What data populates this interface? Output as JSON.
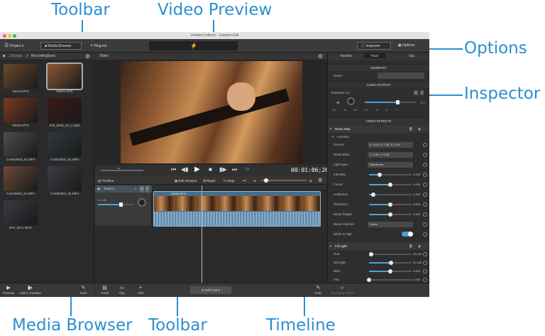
{
  "callouts": {
    "toolbar_top": "Toolbar",
    "video_preview": "Video Preview",
    "options": "Options",
    "inspector": "Inspector",
    "media_browser": "Media Browser",
    "toolbar_bottom": "Toolbar",
    "timeline": "Timeline"
  },
  "colors": {
    "accent": "#2b8fd0",
    "app_bg": "#2c2c2c",
    "selection": "#4aa3df"
  },
  "window": {
    "title": "Untitled (edited) - Catalyst Edit"
  },
  "topbar": {
    "project": "Project",
    "media_browser": "Media Browser",
    "plugins": "Plug-ins",
    "inspector": "Inspector",
    "options": "Options"
  },
  "media_browser": {
    "location_root": "Desktop",
    "location_sep": ">",
    "location_folder": "RecordingSess",
    "items": [
      {
        "name": "00013.MTS",
        "color": "#6b4a2c"
      },
      {
        "name": "00031.MTS",
        "color": "#8a5a34"
      },
      {
        "name": "00034.MTS",
        "color": "#7a3a22"
      },
      {
        "name": "049_0043_01_1.mp4",
        "color": "#3a1a18"
      },
      {
        "name": "CAM10003_01.MP4",
        "color": "#4a5048"
      },
      {
        "name": "CAM10004_01.MP4",
        "color": "#2e3a40"
      },
      {
        "name": "Cam20003_01.MP4",
        "color": "#6a4a36"
      },
      {
        "name": "CAM20004_01.MP4",
        "color": "#3e3c44"
      },
      {
        "name": "MVI_3571.MOV",
        "color": "#3a3a44"
      }
    ],
    "bottom_tools": {
      "preview": "Preview",
      "add_to_timeline": "Add to Timeline",
      "tools": "Tools"
    }
  },
  "video": {
    "header": "Video",
    "timecode": "00:01:06;26"
  },
  "timeline_panel": {
    "header": "Timeline",
    "edit_streams": "Edit Streams",
    "ripple": "Ripple",
    "snap": "Snap",
    "track_name": "Track 1",
    "clip_name": "00031.MTS",
    "level": "0.0 dB",
    "bottom_tools": {
      "track": "Track",
      "clip": "Clip",
      "add": "Add",
      "edit_tool": "Edit Tool",
      "tools": "Tools",
      "keyframe_editor": "Keyframe Editor"
    }
  },
  "inspector": {
    "tabs": [
      "Timeline",
      "Track",
      "Clip"
    ],
    "summary_header": "SUMMARY",
    "name_label": "Name:",
    "audio_header": "AUDIO OUTPUT",
    "channels": "Channels 1-2",
    "m": "M",
    "s": "S",
    "meter_value": "0.0",
    "meter_scale": [
      "-60",
      "-40",
      "-30",
      "-20",
      "-12",
      "-6",
      "0"
    ],
    "effects_header": "VIDEO EFFECTS",
    "bump_map": "Bump Map",
    "location": "Location",
    "rows": [
      {
        "label": "Source:",
        "kind": "field",
        "value": "X: 0.00, Y: 1.00, Z: 1.50"
      },
      {
        "label": "Destination:",
        "kind": "field",
        "value": "X: 0.50, Y: 0.50"
      },
      {
        "label": "Light type:",
        "kind": "field",
        "value": "Directional"
      },
      {
        "label": "Intensity:",
        "kind": "slider",
        "value": "0.250",
        "level": 0.25
      },
      {
        "label": "Focus:",
        "kind": "slider",
        "value": "0.000",
        "level": 0.5
      },
      {
        "label": "Ambience:",
        "kind": "slider",
        "value": "0.100",
        "level": 0.1
      },
      {
        "label": "Shininess:",
        "kind": "slider",
        "value": "0.500",
        "level": 0.5
      },
      {
        "label": "Bump height:",
        "kind": "slider",
        "value": "0.500",
        "level": 0.5
      },
      {
        "label": "Bump channel:",
        "kind": "field",
        "value": "Green"
      },
      {
        "label": "White is high:",
        "kind": "toggle",
        "value": ""
      }
    ],
    "fill_light": "Fill Light",
    "fill_rows": [
      {
        "label": "Hue:",
        "value": "33.400",
        "level": 0.05
      },
      {
        "label": "Strength:",
        "value": "52.180",
        "level": 0.52
      },
      {
        "label": "Bias:",
        "value": "0.000",
        "level": 0.5
      },
      {
        "label": "Tint:",
        "value": "0.000",
        "level": 0.0
      }
    ]
  }
}
